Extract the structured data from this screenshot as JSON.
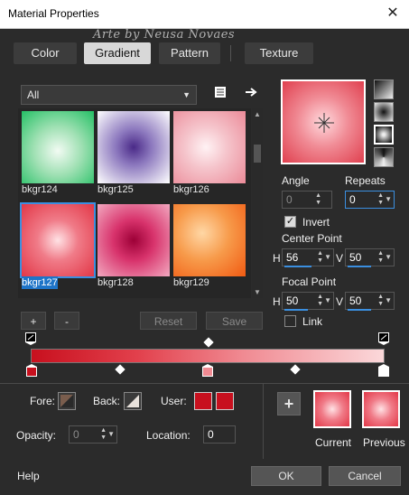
{
  "window": {
    "title": "Material Properties",
    "close_glyph": "✕",
    "watermark": "Arte by  Neusa Novaes"
  },
  "tabs": [
    {
      "label": "Color"
    },
    {
      "label": "Gradient",
      "active": true
    },
    {
      "label": "Pattern"
    },
    {
      "label": "Texture"
    }
  ],
  "library": {
    "category": "All",
    "items": [
      {
        "name": "bkgr124",
        "colors": [
          "#f2fbf3",
          "#24c065"
        ]
      },
      {
        "name": "bkgr125",
        "colors": [
          "#ffffff",
          "#4a2a88"
        ]
      },
      {
        "name": "bkgr126",
        "colors": [
          "#fff2f4",
          "#eb8a98"
        ]
      },
      {
        "name": "bkgr127",
        "colors": [
          "#ffe2e5",
          "#e23747"
        ],
        "selected": true
      },
      {
        "name": "bkgr128",
        "colors": [
          "#9d0037",
          "#f2a9c0"
        ]
      },
      {
        "name": "bkgr129",
        "colors": [
          "#ffd7a5",
          "#f15a12"
        ]
      }
    ],
    "add_label": "+",
    "remove_label": "-",
    "reset_label": "Reset",
    "save_label": "Save"
  },
  "style": {
    "angle_label": "Angle",
    "angle_value": "0",
    "repeats_label": "Repeats",
    "repeats_value": "0",
    "invert_label": "Invert",
    "invert_checked": true,
    "center_label": "Center Point",
    "center_h": "56",
    "center_v": "50",
    "focal_label": "Focal Point",
    "focal_h": "50",
    "focal_v": "50",
    "h_label": "H",
    "v_label": "V",
    "link_label": "Link",
    "link_checked": false
  },
  "gradient_editor": {
    "fore_label": "Fore:",
    "back_label": "Back:",
    "user_label": "User:",
    "opacity_label": "Opacity:",
    "opacity_value": "0",
    "location_label": "Location:",
    "location_value": "0",
    "stop_colors": [
      "#c8101e",
      "#f08a92",
      "#ffffff"
    ],
    "user_color": "#c8101e"
  },
  "compare": {
    "current_label": "Current",
    "previous_label": "Previous",
    "add_glyph": "+"
  },
  "footer": {
    "help_label": "Help",
    "ok_label": "OK",
    "cancel_label": "Cancel"
  }
}
